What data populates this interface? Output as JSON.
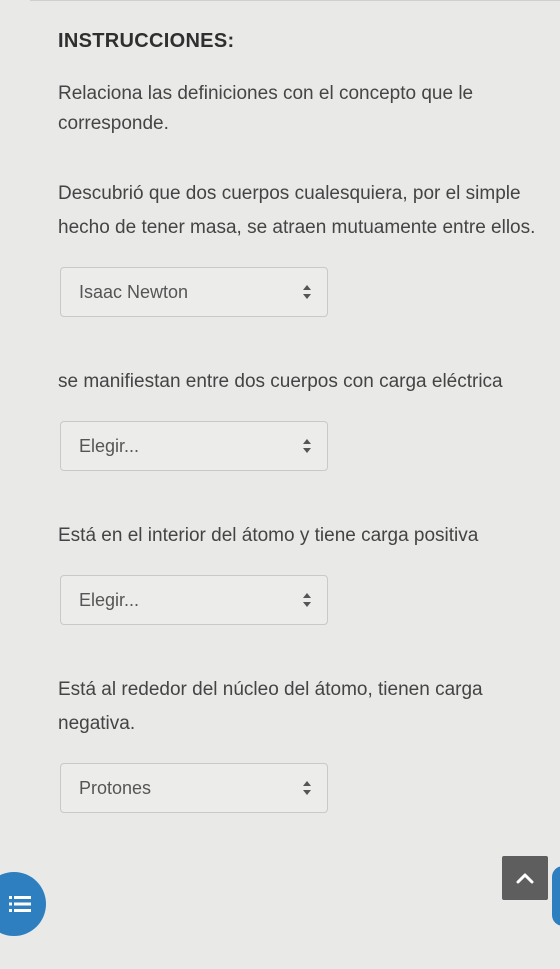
{
  "instructions": {
    "heading": "INSTRUCCIONES:",
    "text": "Relaciona las definiciones con el concepto que le corresponde."
  },
  "questions": [
    {
      "definition": "Descubrió que dos cuerpos cualesquiera, por el simple hecho de tener masa, se atraen mutuamente entre ellos.",
      "selected": "Isaac Newton"
    },
    {
      "definition": "se manifiestan entre dos cuerpos con carga eléctrica",
      "selected": "Elegir..."
    },
    {
      "definition": "Está en el interior del átomo y tiene carga positiva",
      "selected": "Elegir..."
    },
    {
      "definition": "Está al rededor del núcleo del átomo, tienen carga negativa.",
      "selected": "Protones"
    }
  ],
  "icons": {
    "menu": "list-icon",
    "scroll_top": "chevron-up-icon"
  },
  "colors": {
    "accent": "#2d7fbf",
    "scroll_button": "#5e5e5e"
  }
}
